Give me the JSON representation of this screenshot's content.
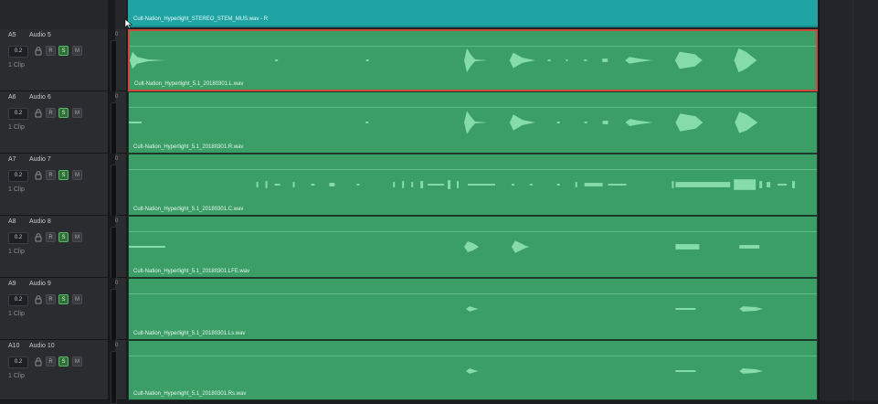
{
  "top_track": {
    "clip_name": "Cult-Nation_Hyperlight_STEREO_STEM_MUS.wav - R"
  },
  "tracks": [
    {
      "id": "A5",
      "name": "Audio 5",
      "volume": "1.0",
      "level": "0.2",
      "r_label": "R",
      "s_label": "S",
      "m_label": "M",
      "clip_count": "1 Clip",
      "clip_name": "Cult-Nation_Hyperlight_5.1_20180301.L.wav",
      "selected": true
    },
    {
      "id": "A6",
      "name": "Audio 6",
      "volume": "1.0",
      "level": "0.2",
      "r_label": "R",
      "s_label": "S",
      "m_label": "M",
      "clip_count": "1 Clip",
      "clip_name": "Cult-Nation_Hyperlight_5.1_20180301.R.wav",
      "selected": false
    },
    {
      "id": "A7",
      "name": "Audio 7",
      "volume": "1.0",
      "level": "0.2",
      "r_label": "R",
      "s_label": "S",
      "m_label": "M",
      "clip_count": "1 Clip",
      "clip_name": "Cult-Nation_Hyperlight_5.1_20180301.C.wav",
      "selected": false
    },
    {
      "id": "A8",
      "name": "Audio 8",
      "volume": "1.0",
      "level": "0.2",
      "r_label": "R",
      "s_label": "S",
      "m_label": "M",
      "clip_count": "1 Clip",
      "clip_name": "Cult-Nation_Hyperlight_5.1_20180301.LFE.wav",
      "selected": false
    },
    {
      "id": "A9",
      "name": "Audio 9",
      "volume": "1.0",
      "level": "0.2",
      "r_label": "R",
      "s_label": "S",
      "m_label": "M",
      "clip_count": "1 Clip",
      "clip_name": "Cult-Nation_Hyperlight_5.1_20180301.Ls.wav",
      "selected": false
    },
    {
      "id": "A10",
      "name": "Audio 10",
      "volume": "1.0",
      "level": "0.2",
      "r_label": "R",
      "s_label": "S",
      "m_label": "M",
      "clip_count": "1 Clip",
      "clip_name": "Cult-Nation_Hyperlight_5.1_20180301.Rs.wav",
      "selected": false
    }
  ],
  "icons": {
    "lock": "lock-icon",
    "cursor": "mouse-cursor-icon"
  },
  "colors": {
    "clip_green": "#3a9e66",
    "clip_teal": "#1fa3a3",
    "selection_red": "#cf4a3c",
    "solo_green": "#58b864",
    "waveform": "#8ee3b0"
  }
}
